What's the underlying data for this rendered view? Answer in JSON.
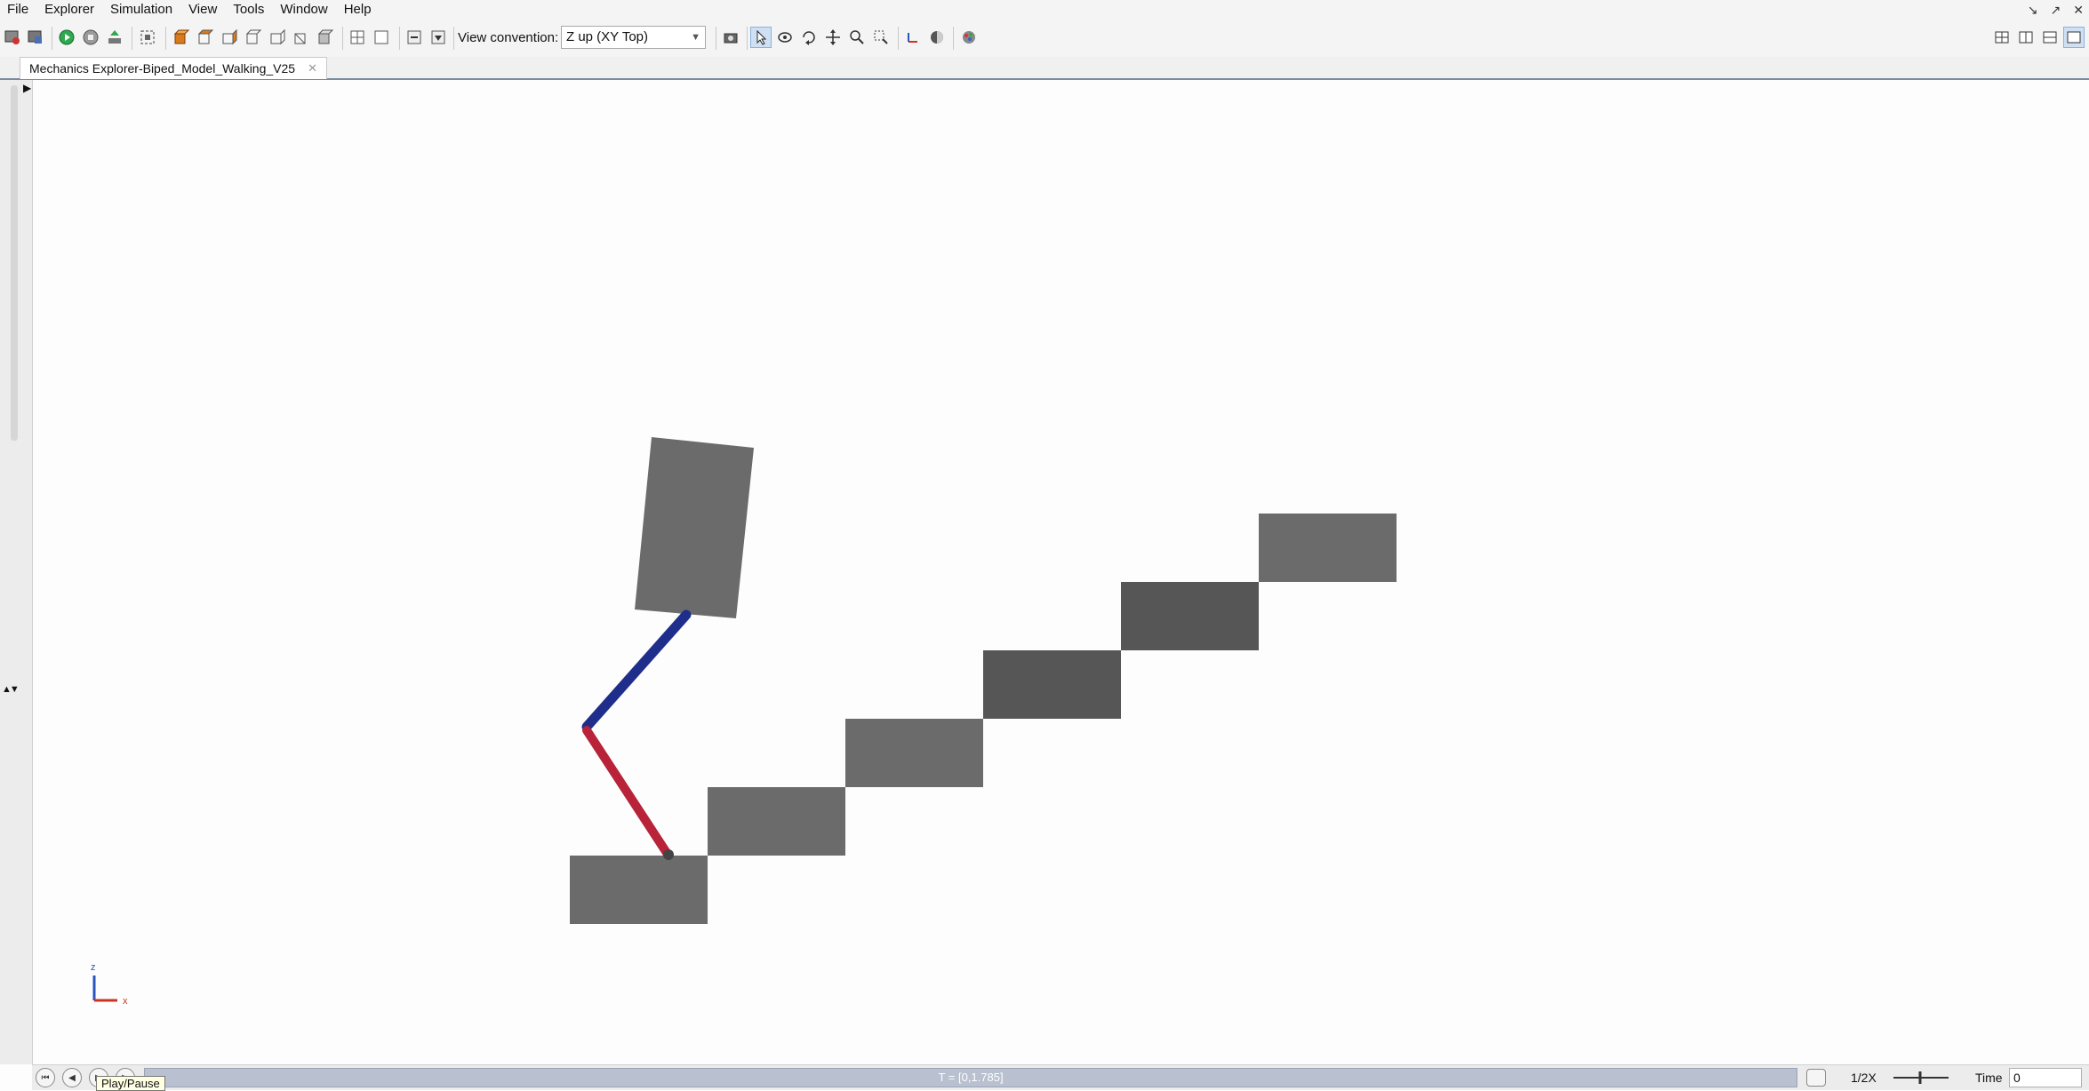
{
  "menu": [
    "File",
    "Explorer",
    "Simulation",
    "View",
    "Tools",
    "Window",
    "Help"
  ],
  "window_controls": [
    "↘",
    "↗",
    "✕"
  ],
  "toolbar": {
    "view_convention_label": "View convention:",
    "view_convention_value": "Z up (XY Top)"
  },
  "tab": {
    "title": "Mechanics Explorer-Biped_Model_Walking_V25",
    "close": "✕"
  },
  "scene": {
    "axis_triad": {
      "z_label": "z",
      "x_label": "x"
    },
    "colors": {
      "body": "#6b6b6b",
      "stair_light": "#6b6b6b",
      "stair_dark": "#565656",
      "upper_leg": "#1f2e8a",
      "lower_leg": "#b8233a"
    }
  },
  "playback": {
    "timeline_text": "T = [0,1.785]",
    "tooltip": "Play/Pause",
    "speed": "1/2X",
    "time_label": "Time",
    "time_value": "0"
  }
}
